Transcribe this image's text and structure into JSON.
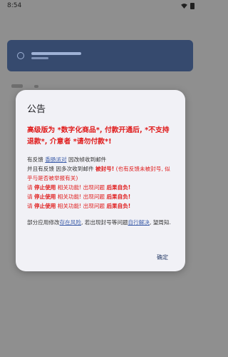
{
  "statusbar": {
    "time": "8:54"
  },
  "dialog": {
    "title": "公告",
    "headline": "高级版为 *数字化商品*, 付款开通后, *不支持退款*, 介意者 *请勿付款*!",
    "line1": {
      "pre": "有反馈 ",
      "link": "香肠派对",
      "post": " 因改帧收到邮件"
    },
    "line2": {
      "pre": "并且有反馈 因多次收到邮件 ",
      "red_bold": "被封号!",
      "red_rest": " (也有反馈未被封号, 似乎与是否被举报有关)"
    },
    "warn_lines": [
      {
        "a": "请 ",
        "b": "停止使用",
        "c": " 相关功能! 出现问题 ",
        "d": "后果自负!"
      },
      {
        "a": "请 ",
        "b": "停止使用",
        "c": " 相关功能! 出现问题 ",
        "d": "后果自负!"
      },
      {
        "a": "请 ",
        "b": "停止使用",
        "c": " 相关功能! 出现问题 ",
        "d": "后果自负!"
      }
    ],
    "footer_note": {
      "pre": "部分应用修改",
      "link1": "存在风险",
      "mid": ", 若出现封号等问题",
      "link2": "自行解决",
      "post": ", 望周知."
    },
    "confirm_label": "确定"
  },
  "colors": {
    "accent_red": "#e01b1b",
    "link_blue": "#3a5ba8",
    "dialog_bg": "#f1f1f6"
  }
}
